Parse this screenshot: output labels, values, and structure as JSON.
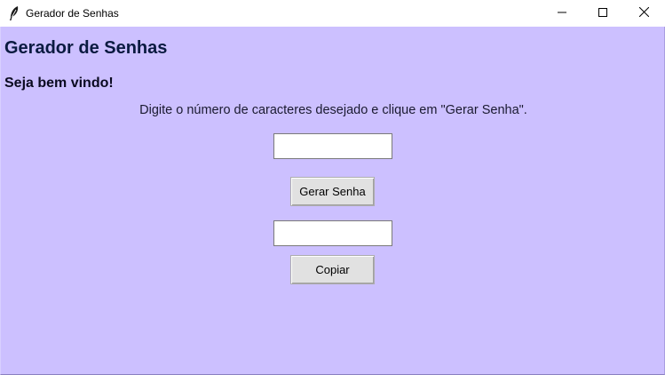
{
  "window": {
    "title": "Gerador de Senhas",
    "minimize_icon": "minimize-icon",
    "maximize_icon": "maximize-icon",
    "close_icon": "close-icon",
    "app_icon": "feather-icon"
  },
  "main": {
    "heading": "Gerador de Senhas",
    "welcome": "Seja bem vindo!",
    "instruction": "Digite o número de caracteres desejado e clique em \"Gerar Senha\".",
    "length_input": {
      "value": "",
      "placeholder": ""
    },
    "generate_label": "Gerar Senha",
    "password_output": {
      "value": "",
      "placeholder": ""
    },
    "copy_label": "Copiar"
  },
  "colors": {
    "background": "#ccc0ff",
    "button": "#e1e1e1",
    "heading": "#0a1a40"
  }
}
